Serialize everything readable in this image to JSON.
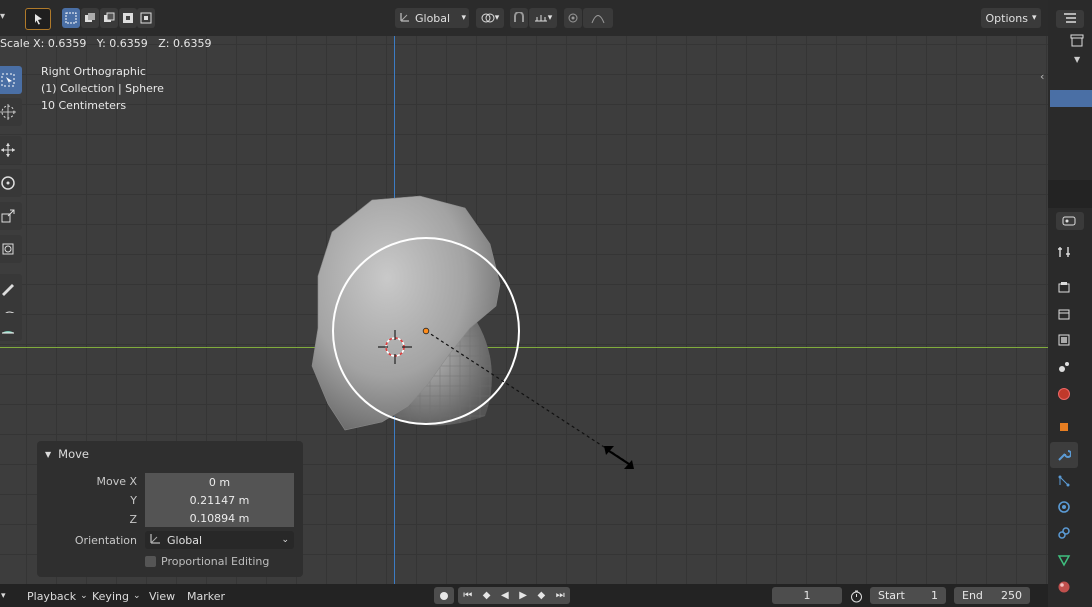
{
  "header": {
    "orientation_label": "Global",
    "options_label": "Options"
  },
  "status_text": "Scale X: 0.6359   Y: 0.6359   Z: 0.6359",
  "viewport_info": {
    "view_name": "Right Orthographic",
    "collection": "(1) Collection | Sphere",
    "scale": "10 Centimeters"
  },
  "move_panel": {
    "title": "Move",
    "rows": [
      {
        "label": "Move X",
        "value": "0 m"
      },
      {
        "label": "Y",
        "value": "0.21147 m"
      },
      {
        "label": "Z",
        "value": "0.10894 m"
      }
    ],
    "orientation_label": "Orientation",
    "orientation_value": "Global",
    "proportional_label": "Proportional Editing"
  },
  "timeline": {
    "playback": "Playback",
    "keying": "Keying",
    "view": "View",
    "marker": "Marker",
    "current_frame": "1",
    "start_label": "Start",
    "start_value": "1",
    "end_label": "End",
    "end_value": "250"
  },
  "colors": {
    "accent": "#4a6fa5",
    "x_axis": "#8cc03c",
    "z_axis": "#3c7cc4",
    "origin": "#ff8c1a"
  }
}
